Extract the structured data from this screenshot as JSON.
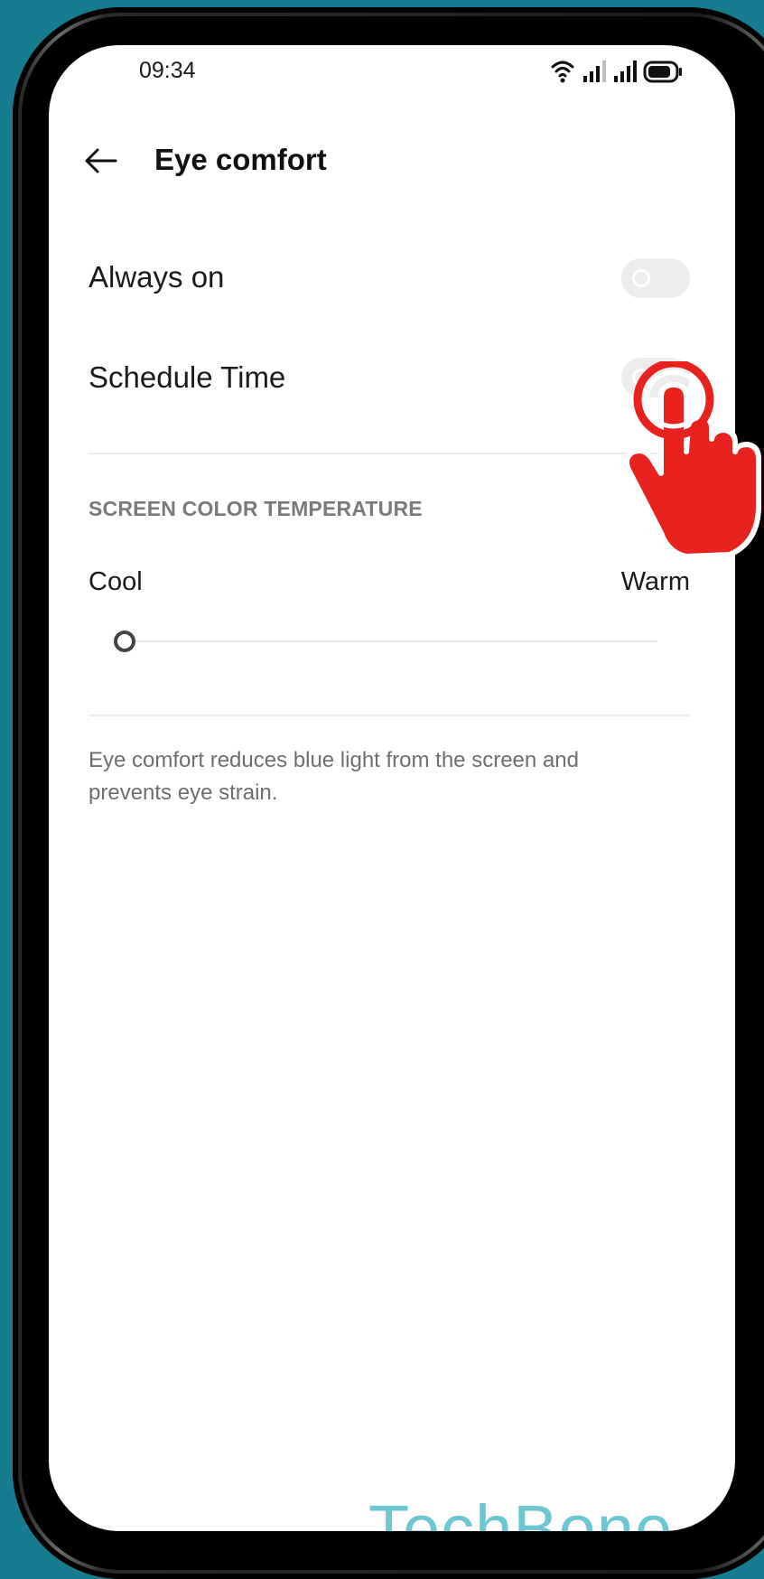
{
  "status_bar": {
    "time": "09:34",
    "icons": [
      "wifi-icon",
      "signal-1-icon",
      "signal-2-icon",
      "battery-icon"
    ]
  },
  "header": {
    "back_icon": "arrow-left-icon",
    "title": "Eye comfort"
  },
  "settings": {
    "always_on": {
      "label": "Always on",
      "enabled": false
    },
    "schedule_time": {
      "label": "Schedule Time",
      "enabled": false
    }
  },
  "color_temperature": {
    "section_title": "SCREEN COLOR TEMPERATURE",
    "min_label": "Cool",
    "max_label": "Warm",
    "value_fraction": 0.0
  },
  "description": "Eye comfort reduces blue light from the screen and prevents eye strain.",
  "overlay": {
    "tap_indicator": "tap-hand-icon",
    "watermark": "TechBone"
  },
  "colors": {
    "background": "#157d8f",
    "screen": "#ffffff",
    "toggle_off": "#ececec",
    "tap_indicator": "#e8231f",
    "watermark": "#6cc7d3"
  }
}
